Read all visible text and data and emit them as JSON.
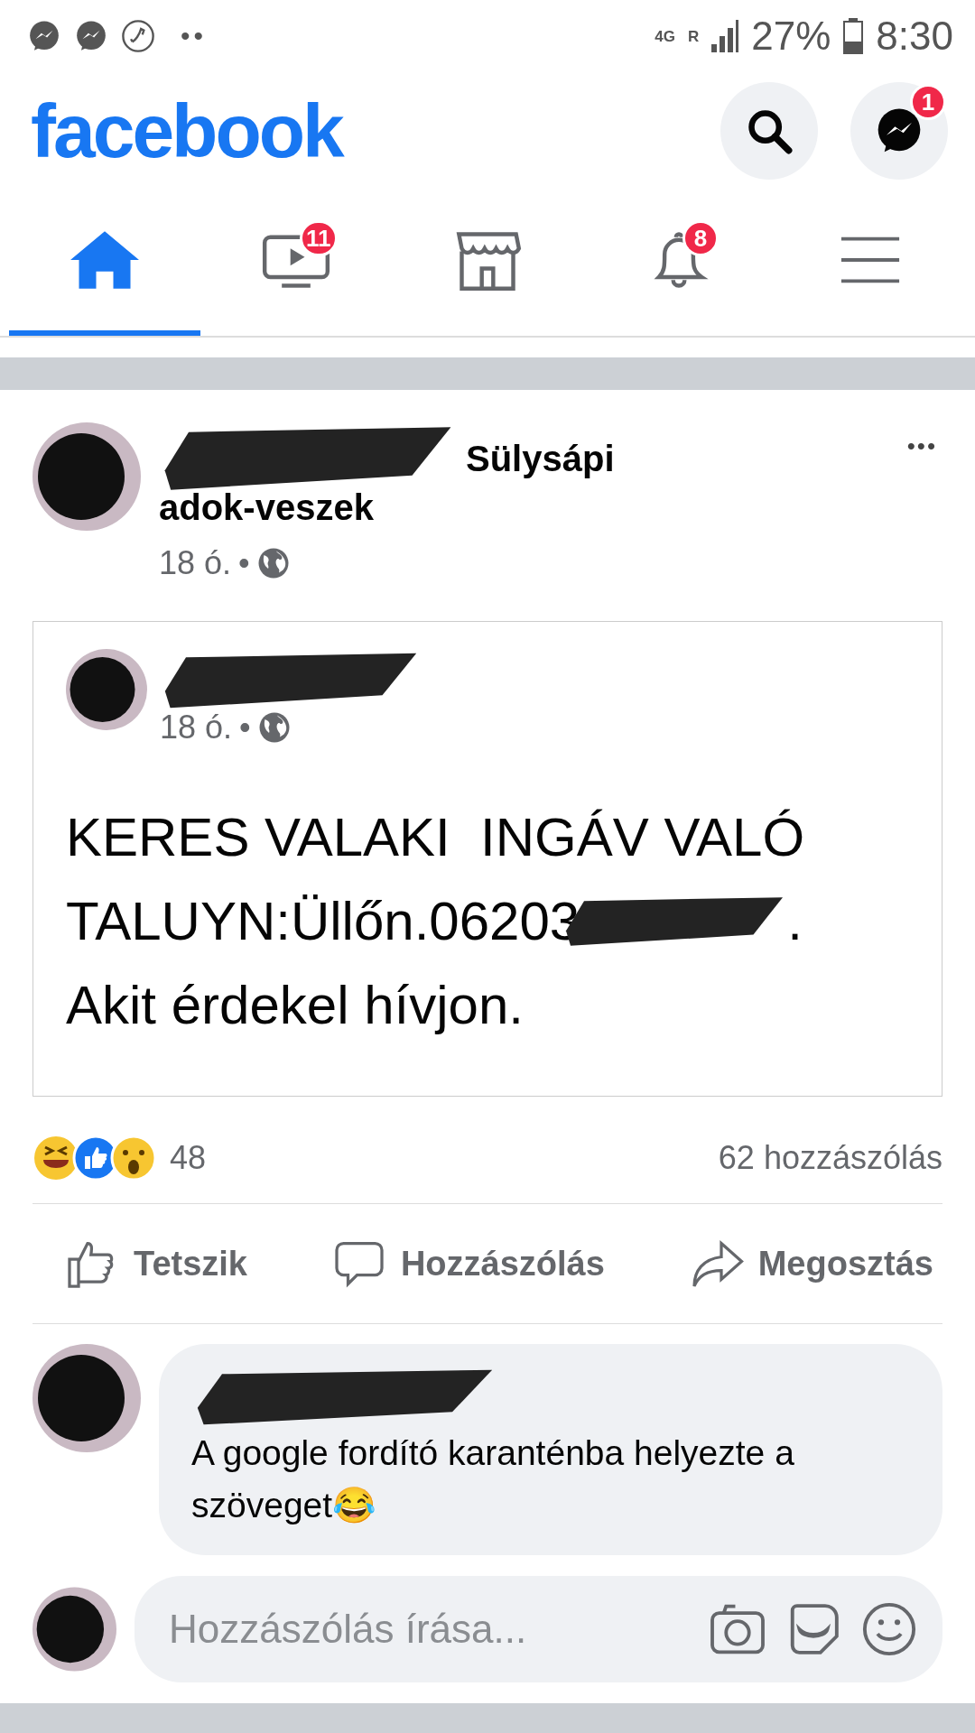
{
  "status_bar": {
    "more_notifications": "••",
    "network": "4G",
    "roaming": "R",
    "battery": "27%",
    "time": "8:30"
  },
  "header": {
    "logo": "facebook",
    "messenger_badge": "1"
  },
  "tabs": [
    {
      "kind": "home",
      "selected": true
    },
    {
      "kind": "video",
      "selected": false,
      "badge": "11"
    },
    {
      "kind": "marketplace",
      "selected": false
    },
    {
      "kind": "notifications",
      "selected": false,
      "badge": "8"
    },
    {
      "kind": "menu",
      "selected": false
    }
  ],
  "post": {
    "group": "Sülysápi",
    "group_line2": "adok-veszek",
    "time": "18 ó.",
    "separator": "•",
    "more": "•••",
    "shared": {
      "time": "18 ó.",
      "separator": "•",
      "lines": [
        {
          "text": "KERES VALAKI  INGÁV VALÓ"
        },
        {
          "text": "TALUYN:Üllőn.06203",
          "redacted_after": true,
          "tail": "."
        },
        {
          "text": "Akit érdekel hívjon."
        }
      ]
    },
    "reactions_count": "48",
    "comments_count": "62 hozzászólás",
    "actions": [
      {
        "kind": "like",
        "label": "Tetszik"
      },
      {
        "kind": "comment",
        "label": "Hozzászólás"
      },
      {
        "kind": "share",
        "label": "Megosztás"
      }
    ],
    "comment": {
      "text": "A google fordító karanténba helyezte a szöveget😂"
    },
    "composer": {
      "placeholder": "Hozzászólás írása..."
    }
  }
}
